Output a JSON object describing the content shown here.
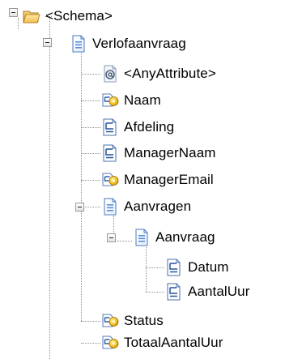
{
  "tree": {
    "root": {
      "label": "<Schema>",
      "icon": "folder-open-icon"
    },
    "verlofaanvraag": {
      "label": "Verlofaanvraag",
      "icon": "document-icon"
    },
    "anyattribute": {
      "label": "<AnyAttribute>",
      "icon": "at-attribute-icon"
    },
    "naam": {
      "label": "Naam",
      "icon": "key-element-icon"
    },
    "afdeling": {
      "label": "Afdeling",
      "icon": "element-icon"
    },
    "managernaam": {
      "label": "ManagerNaam",
      "icon": "element-icon"
    },
    "manageremail": {
      "label": "ManagerEmail",
      "icon": "key-element-icon"
    },
    "aanvragen": {
      "label": "Aanvragen",
      "icon": "document-icon"
    },
    "aanvraag": {
      "label": "Aanvraag",
      "icon": "document-icon"
    },
    "datum": {
      "label": "Datum",
      "icon": "element-icon"
    },
    "aantaluur": {
      "label": "AantalUur",
      "icon": "element-icon"
    },
    "status": {
      "label": "Status",
      "icon": "key-element-icon"
    },
    "totaalaantaluur": {
      "label": "TotaalAantalUur",
      "icon": "key-element-icon"
    }
  }
}
